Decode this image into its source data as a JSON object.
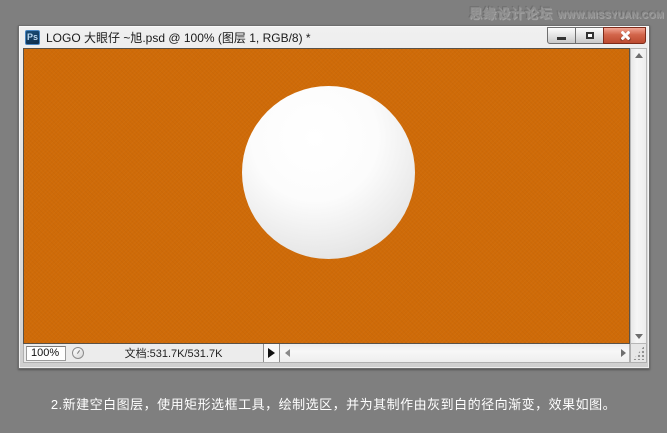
{
  "watermark": {
    "forum_name": "思缘设计论坛",
    "site_url": "WWW.MISSYUAN.COM"
  },
  "window": {
    "app_icon_label": "Ps",
    "title": "LOGO 大眼仔 ~旭.psd @ 100% (图层 1, RGB/8) *"
  },
  "document_canvas": {
    "background_color": "#CF6B08",
    "sphere_center_color": "#FFFFFF",
    "sphere_edge_color": "#D6D6D6"
  },
  "status_bar": {
    "zoom_level": "100%",
    "document_info": "文档:531.7K/531.7K"
  },
  "caption": "2.新建空白图层，使用矩形选框工具，绘制选区，并为其制作由灰到白的径向渐变，效果如图。",
  "colors": {
    "page_background": "#7F7F7F",
    "close_button_red": "#C75641",
    "window_chrome": "#DEDEDE"
  }
}
